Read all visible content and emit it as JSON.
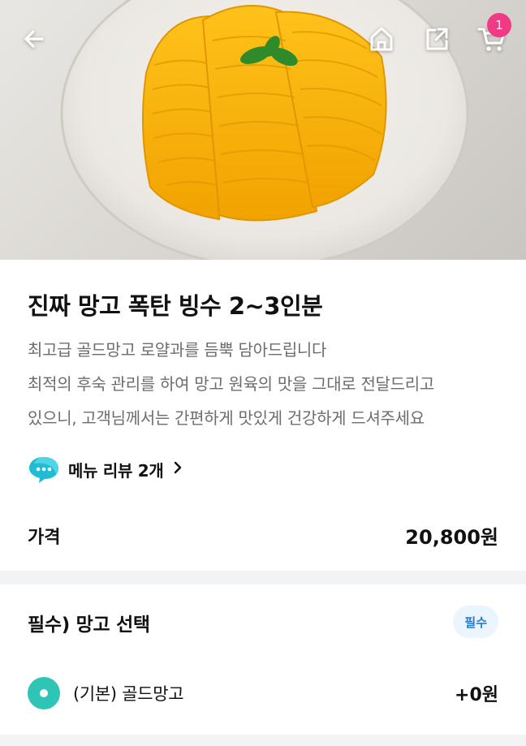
{
  "header": {
    "back_icon": "arrow-left-icon",
    "home_icon": "home-icon",
    "share_icon": "share-icon",
    "cart_icon": "cart-icon",
    "cart_count": "1"
  },
  "product": {
    "title": "진짜 망고 폭탄 빙수 2~3인분",
    "description": [
      "최고급 골드망고 로얄과를 듬뿍 담아드립니다",
      "최적의 후숙 관리를 하여 망고 원육의 맛을 그대로 전달드리고",
      "있으니, 고객님께서는 간편하게 맛있게 건강하게 드셔주세요"
    ],
    "review_link": "메뉴 리뷰 2개",
    "price_label": "가격",
    "price_value": "20,800원"
  },
  "option_group": {
    "title": "필수) 망고 선택",
    "badge": "필수",
    "options": [
      {
        "label": "(기본) 골드망고",
        "price": "+0원",
        "selected": true
      }
    ]
  },
  "colors": {
    "accent": "#2ec4b6",
    "badge_pink": "#ef3b86",
    "required_badge_bg": "#eaf5fd",
    "required_badge_text": "#1f7bd8"
  }
}
